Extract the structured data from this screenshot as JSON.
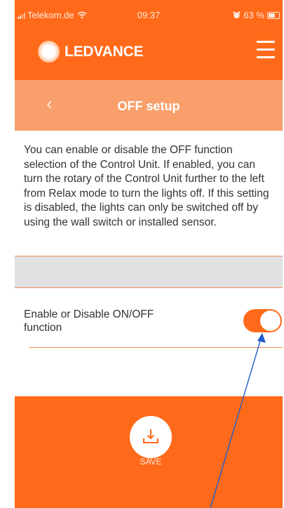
{
  "status_bar": {
    "carrier": "Telekom.de",
    "time": "09:37",
    "battery": "63 %"
  },
  "header": {
    "brand": "LEDVANCE",
    "menu_icon": "hamburger-menu-icon"
  },
  "title_bar": {
    "back_icon": "chevron-left-icon",
    "title": "OFF setup"
  },
  "description": "You can enable or disable the OFF function selection of the Control Unit. If enabled, you can turn the rotary of the Control Unit further to the left from Relax mode to turn the lights off. If this setting is disabled, the lights can only be switched off by using the wall switch or installed sensor.",
  "setting": {
    "label": "Enable or Disable ON/OFF function",
    "enabled": true
  },
  "footer": {
    "save_label": "SAVE",
    "save_icon": "download-tray-icon"
  },
  "colors": {
    "brand_orange": "#ff6a1a",
    "title_bar_orange": "#f99f6b",
    "annotation_arrow": "#1f5cc7"
  }
}
